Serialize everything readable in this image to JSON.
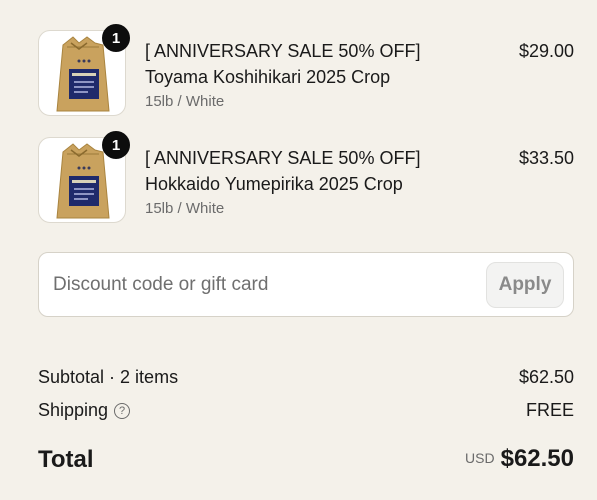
{
  "cart": {
    "items": [
      {
        "quantity": "1",
        "title_line1": "[ ANNIVERSARY SALE 50% OFF]",
        "title_line2": "Toyama Koshihikari 2025 Crop",
        "variant": "15lb / White",
        "price": "$29.00",
        "image_icon": "rice-bag-icon"
      },
      {
        "quantity": "1",
        "title_line1": "[ ANNIVERSARY SALE 50% OFF]",
        "title_line2": "Hokkaido Yumepirika 2025 Crop",
        "variant": "15lb / White",
        "price": "$33.50",
        "image_icon": "rice-bag-icon"
      }
    ]
  },
  "discount": {
    "placeholder": "Discount code or gift card",
    "value": "",
    "apply_label": "Apply"
  },
  "summary": {
    "subtotal_label": "Subtotal · 2 items",
    "subtotal_value": "$62.50",
    "shipping_label": "Shipping",
    "shipping_help_icon": "question-circle-icon",
    "shipping_value": "FREE",
    "total_label": "Total",
    "currency": "USD",
    "total_value": "$62.50"
  },
  "colors": {
    "background": "#f4f1ea",
    "badge": "#0d0d0d",
    "bag_kraft": "#c9a25e",
    "bag_label": "#1f2a6b"
  }
}
